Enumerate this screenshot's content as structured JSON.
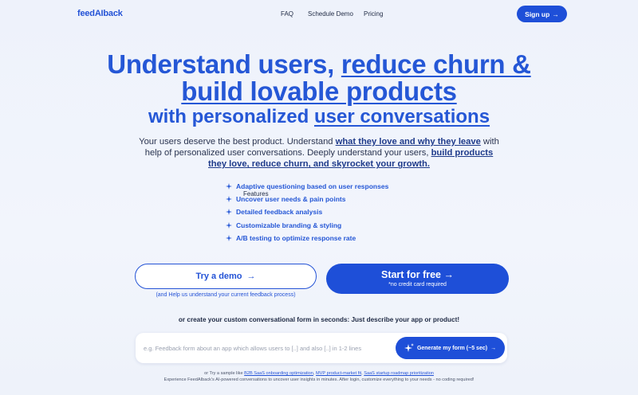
{
  "nav": {
    "logo": "feedAIback",
    "links": [
      "Features",
      "FAQ",
      "Schedule Demo",
      "Pricing"
    ],
    "signup_label": "Sign up",
    "signup_arrow": "→"
  },
  "hero": {
    "title_part1": "Understand users, ",
    "title_part2": "reduce churn &",
    "title_part3": "build lovable products",
    "subtitle_part1": "with personalized ",
    "subtitle_part2": "user conversations",
    "desc_part1": "Your users deserve the best product. Understand ",
    "desc_link1": "what they love and why they leave",
    "desc_part2": " with help of personalized user conversations. Deeply understand your users, ",
    "desc_link2": "build products they love, reduce churn, and skyrocket your growth."
  },
  "features": [
    "Adaptive questioning based on user responses",
    "Uncover user needs & pain points",
    "Detailed feedback analysis",
    "Customizable branding & styling",
    "A/B testing to optimize response rate"
  ],
  "cta": {
    "demo_label": "Try a demo",
    "demo_arrow": "→",
    "demo_help": "(and Help us understand your current feedback process)",
    "start_label": "Start for free",
    "start_arrow": "→",
    "start_note": "*no credit card required"
  },
  "generate": {
    "or_text": "or create your custom conversational form in seconds: Just describe your app or product!",
    "placeholder": "e.g. Feedback form about an app which allows users to [..] and also [..] in 1-2 lines",
    "button_label": "Generate my form (~5 sec)",
    "button_arrow": "→"
  },
  "samples": {
    "prefix": "or Try a sample like ",
    "links": [
      "B2B SaaS onboarding optimization",
      "MVP product-market fit",
      "SaaS startup roadmap prioritization"
    ],
    "sep": ", ",
    "note": "Experience FeedAIback's AI-powered conversations to uncover user insights in minutes. After login, customize everything to your needs - no coding required!"
  },
  "colors": {
    "accent": "#1e4fd8",
    "heading": "#2557d6",
    "background": "#eef2fb"
  }
}
